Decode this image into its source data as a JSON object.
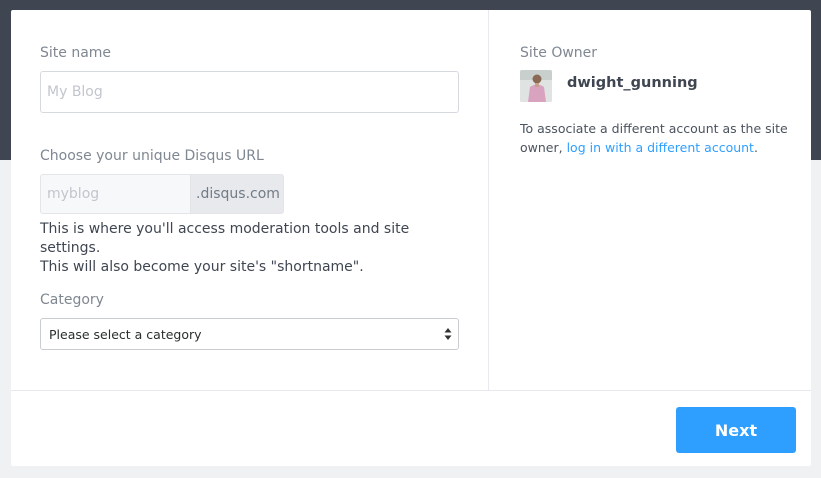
{
  "form": {
    "site_name_label": "Site name",
    "site_name_placeholder": "My Blog",
    "url_label": "Choose your unique Disqus URL",
    "url_placeholder": "myblog",
    "url_suffix": ".disqus.com",
    "url_help_line1": "This is where you'll access moderation tools and site settings.",
    "url_help_line2": "This will also become your site's \"shortname\".",
    "category_label": "Category",
    "category_selected": "Please select a category"
  },
  "owner": {
    "label": "Site Owner",
    "username": "dwight_gunning",
    "associate_text": "To associate a different account as the site owner, ",
    "associate_link": "log in with a different account",
    "associate_end": "."
  },
  "footer": {
    "next_label": "Next"
  },
  "colors": {
    "accent": "#2e9fff",
    "header_band": "#3f4651"
  }
}
